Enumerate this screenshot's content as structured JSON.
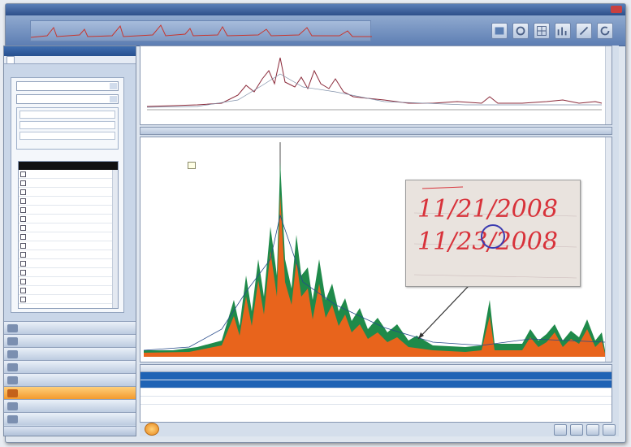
{
  "colors": {
    "accent_blue": "#2d5ea6",
    "nav_active": "#f39a2e",
    "spectrum_orange": "#e8641c",
    "spectrum_green": "#1f8a4a",
    "handwriting_red": "#d8323a",
    "selection_blue": "#1f63b5"
  },
  "toolbar": {
    "icons": [
      "view-icon",
      "settings-icon",
      "grid-icon",
      "chart-icon",
      "tools-icon",
      "refresh-icon"
    ]
  },
  "inset": {
    "line1": "11/21/2008",
    "line2": "11/23/2008"
  },
  "left_nav": {
    "active_index": 5,
    "item_count": 8
  },
  "grid": {
    "row_count": 4,
    "selected_rows": [
      0,
      1
    ]
  }
}
